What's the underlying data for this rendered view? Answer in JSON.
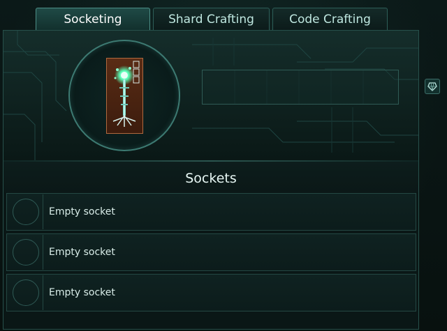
{
  "tabs": [
    {
      "label": "Socketing",
      "active": true
    },
    {
      "label": "Shard Crafting",
      "active": false
    },
    {
      "label": "Code Crafting",
      "active": false
    }
  ],
  "sockets": {
    "title": "Sockets",
    "items": [
      {
        "label": "Empty socket"
      },
      {
        "label": "Empty socket"
      },
      {
        "label": "Empty socket"
      }
    ]
  },
  "icons": {
    "item": "circuit-totem-icon",
    "side": "gem-icon"
  },
  "colors": {
    "accent": "#4d8f87",
    "item_border": "#b0693f",
    "glow": "#59ffb6"
  }
}
